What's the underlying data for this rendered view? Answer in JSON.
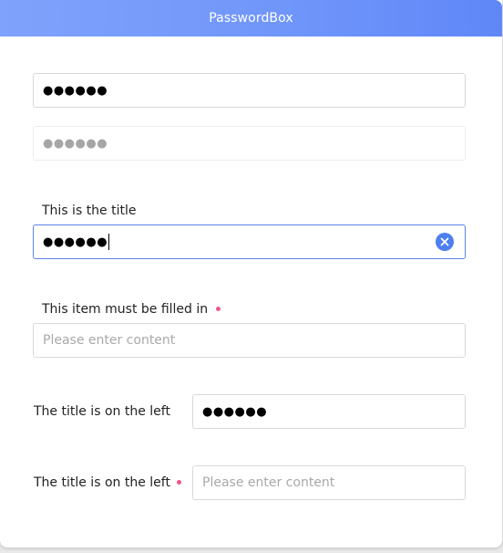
{
  "window": {
    "title": "PasswordBox"
  },
  "fields": {
    "password1": {
      "masked": "●●●●●●"
    },
    "password_disabled": {
      "masked": "●●●●●●"
    },
    "titled": {
      "title": "This is the title",
      "masked": "●●●●●●"
    },
    "required": {
      "title": "This item must be filled in",
      "placeholder": "Please enter content"
    },
    "left_title": {
      "title": "The title is on the left",
      "masked": "●●●●●●"
    },
    "left_title_required": {
      "title": "The title is on the left",
      "placeholder": "Please enter content"
    }
  },
  "icons": {
    "clear": "close-circle-icon",
    "required": "required-dot"
  },
  "colors": {
    "titlebar_start": "#7fa2fb",
    "titlebar_end": "#5f87f7",
    "focus_border": "#5b82ea",
    "clear_button": "#4e7ff0",
    "required_dot": "#f0558a"
  }
}
